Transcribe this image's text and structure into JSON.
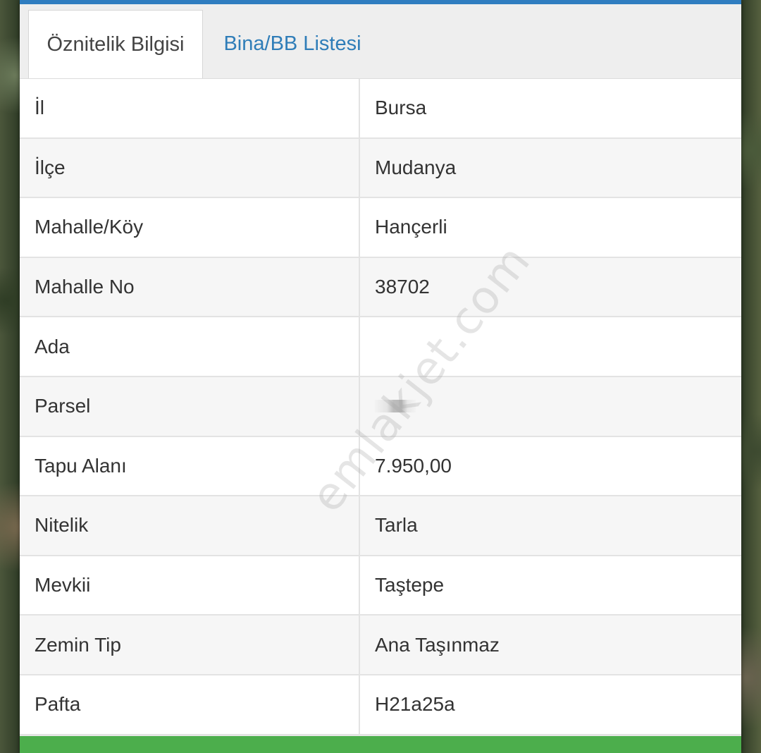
{
  "tabs": [
    {
      "label": "Öznitelik Bilgisi",
      "active": true
    },
    {
      "label": "Bina/BB Listesi",
      "active": false
    }
  ],
  "rows": [
    {
      "key": "İl",
      "value": "Bursa"
    },
    {
      "key": "İlçe",
      "value": "Mudanya"
    },
    {
      "key": "Mahalle/Köy",
      "value": "Hançerli"
    },
    {
      "key": "Mahalle No",
      "value": "38702"
    },
    {
      "key": "Ada",
      "value": ""
    },
    {
      "key": "Parsel",
      "value": ""
    },
    {
      "key": "Tapu Alanı",
      "value": "7.950,00"
    },
    {
      "key": "Nitelik",
      "value": "Tarla"
    },
    {
      "key": "Mevkii",
      "value": "Taştepe"
    },
    {
      "key": "Zemin Tip",
      "value": "Ana Taşınmaz"
    },
    {
      "key": "Pafta",
      "value": "H21a25a"
    }
  ],
  "watermark": "emlakjet.com",
  "colors": {
    "accent": "#2f7dc0",
    "tab_link": "#2f7db8",
    "action_bar": "#4cae4c"
  }
}
